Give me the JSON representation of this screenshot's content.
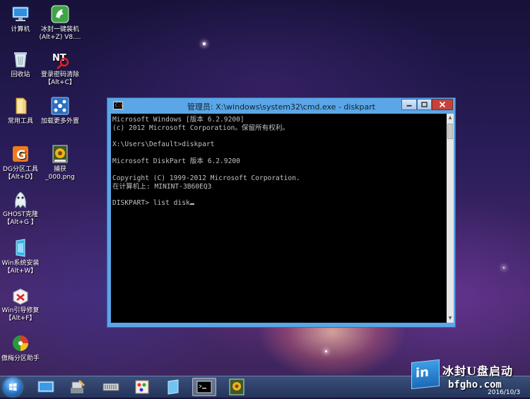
{
  "desktop_icons": [
    {
      "label": "计算机",
      "icon": "computer-icon"
    },
    {
      "label": "冰封一键装机",
      "sub": "(Alt+Z) V8....",
      "icon": "installer-icon"
    },
    {
      "label": "回收站",
      "icon": "recycle-bin-icon"
    },
    {
      "label": "登录密码清除",
      "sub": "【Alt+C】",
      "icon": "password-clear-icon"
    },
    {
      "label": "常用工具",
      "icon": "folder-icon"
    },
    {
      "label": "加载更多外置",
      "icon": "load-external-icon"
    },
    {
      "label": "DG分区工具",
      "sub": "【Alt+D】",
      "icon": "dg-partition-icon"
    },
    {
      "label": "捕获",
      "sub": "_000.png",
      "icon": "png-file-icon"
    },
    {
      "label": "GHOST克隆",
      "sub": "【Alt+G 】",
      "icon": "ghost-icon"
    },
    {
      "label": "Win系统安装",
      "sub": "【Alt+W】",
      "icon": "win-install-icon"
    },
    {
      "label": "Win引导修复",
      "sub": "【Alt+F】",
      "icon": "boot-repair-icon"
    },
    {
      "label": "傲梅分区助手",
      "icon": "aomei-partition-icon"
    }
  ],
  "window": {
    "title": "管理员: X:\\windows\\system32\\cmd.exe - diskpart",
    "icon_text": "C:\\",
    "console_lines": [
      "Microsoft Windows [版本 6.2.9200]",
      "(c) 2012 Microsoft Corporation。保留所有权利。",
      "",
      "X:\\Users\\Default>diskpart",
      "",
      "Microsoft DiskPart 版本 6.2.9200",
      "",
      "Copyright (C) 1999-2012 Microsoft Corporation.",
      "在计算机上: MININT-3B60EQ3",
      "",
      "DISKPART> list disk"
    ]
  },
  "taskbar": {
    "items": [
      "desktop-icon",
      "tools-icon",
      "hardware-icon",
      "paint-icon",
      "notepad-icon",
      "cmd-icon",
      "image-viewer-icon"
    ],
    "active_item": "cmd-icon"
  },
  "brand": {
    "logo_text": "in",
    "name": "冰封U盘启动",
    "url": "bfgho.com",
    "date": "2016/10/3"
  }
}
